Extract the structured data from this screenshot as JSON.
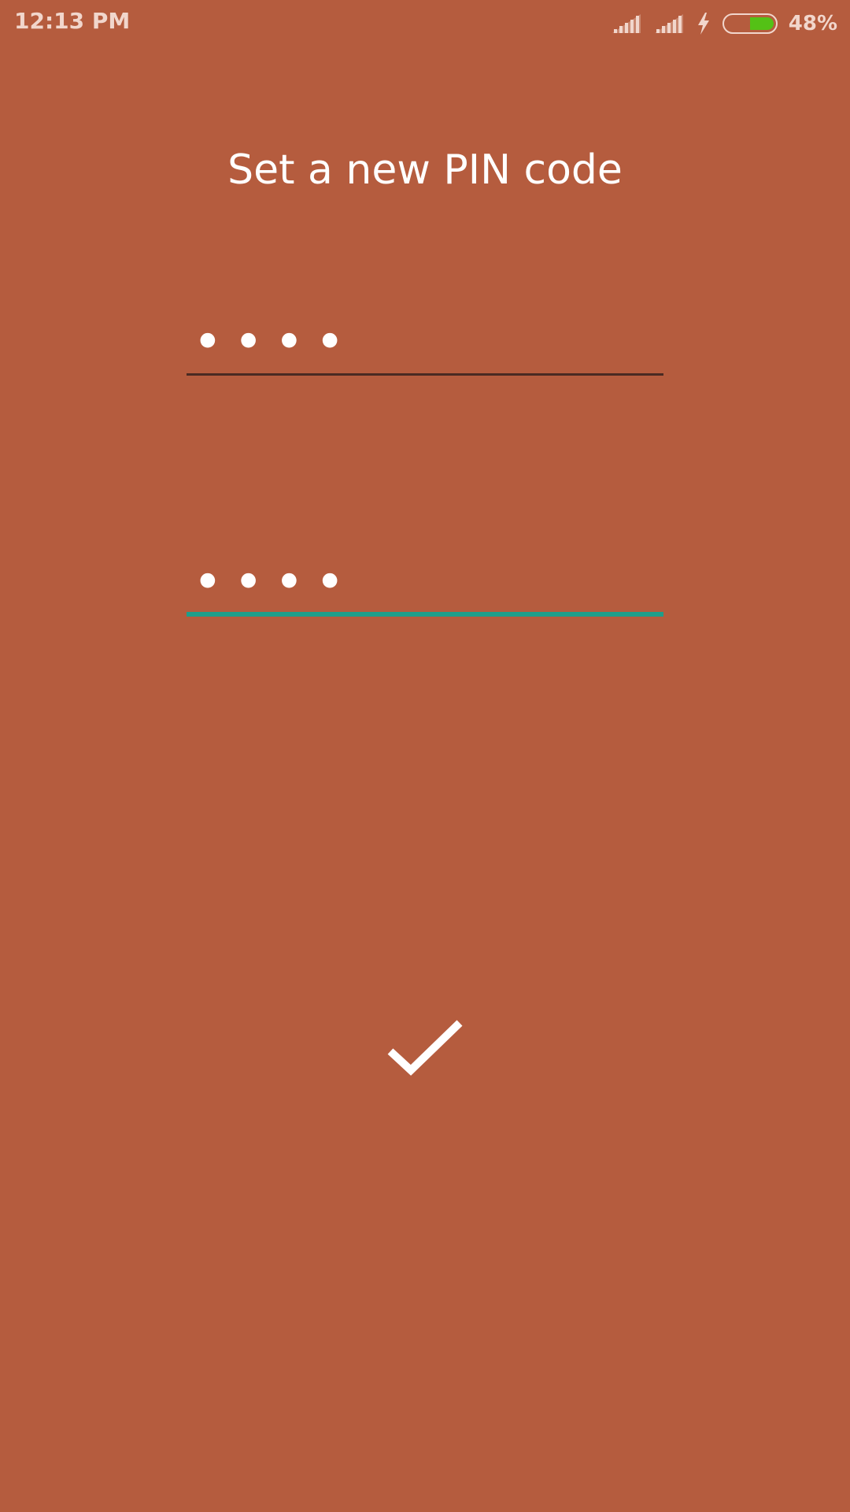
{
  "status_bar": {
    "time": "12:13 PM",
    "battery_percent": "48%",
    "battery_level": 0.48,
    "battery_color": "#54c116",
    "icons": [
      "signal-icon",
      "signal-icon",
      "charging-bolt-icon",
      "battery-icon"
    ]
  },
  "page": {
    "title": "Set a new PIN code",
    "background_color": "#b55c3e"
  },
  "pin_fields": [
    {
      "value": "••••",
      "focused": false
    },
    {
      "value": "••••",
      "focused": true
    }
  ],
  "accent_color": "#1f9e8a",
  "confirm_button": {
    "icon": "check-icon"
  }
}
